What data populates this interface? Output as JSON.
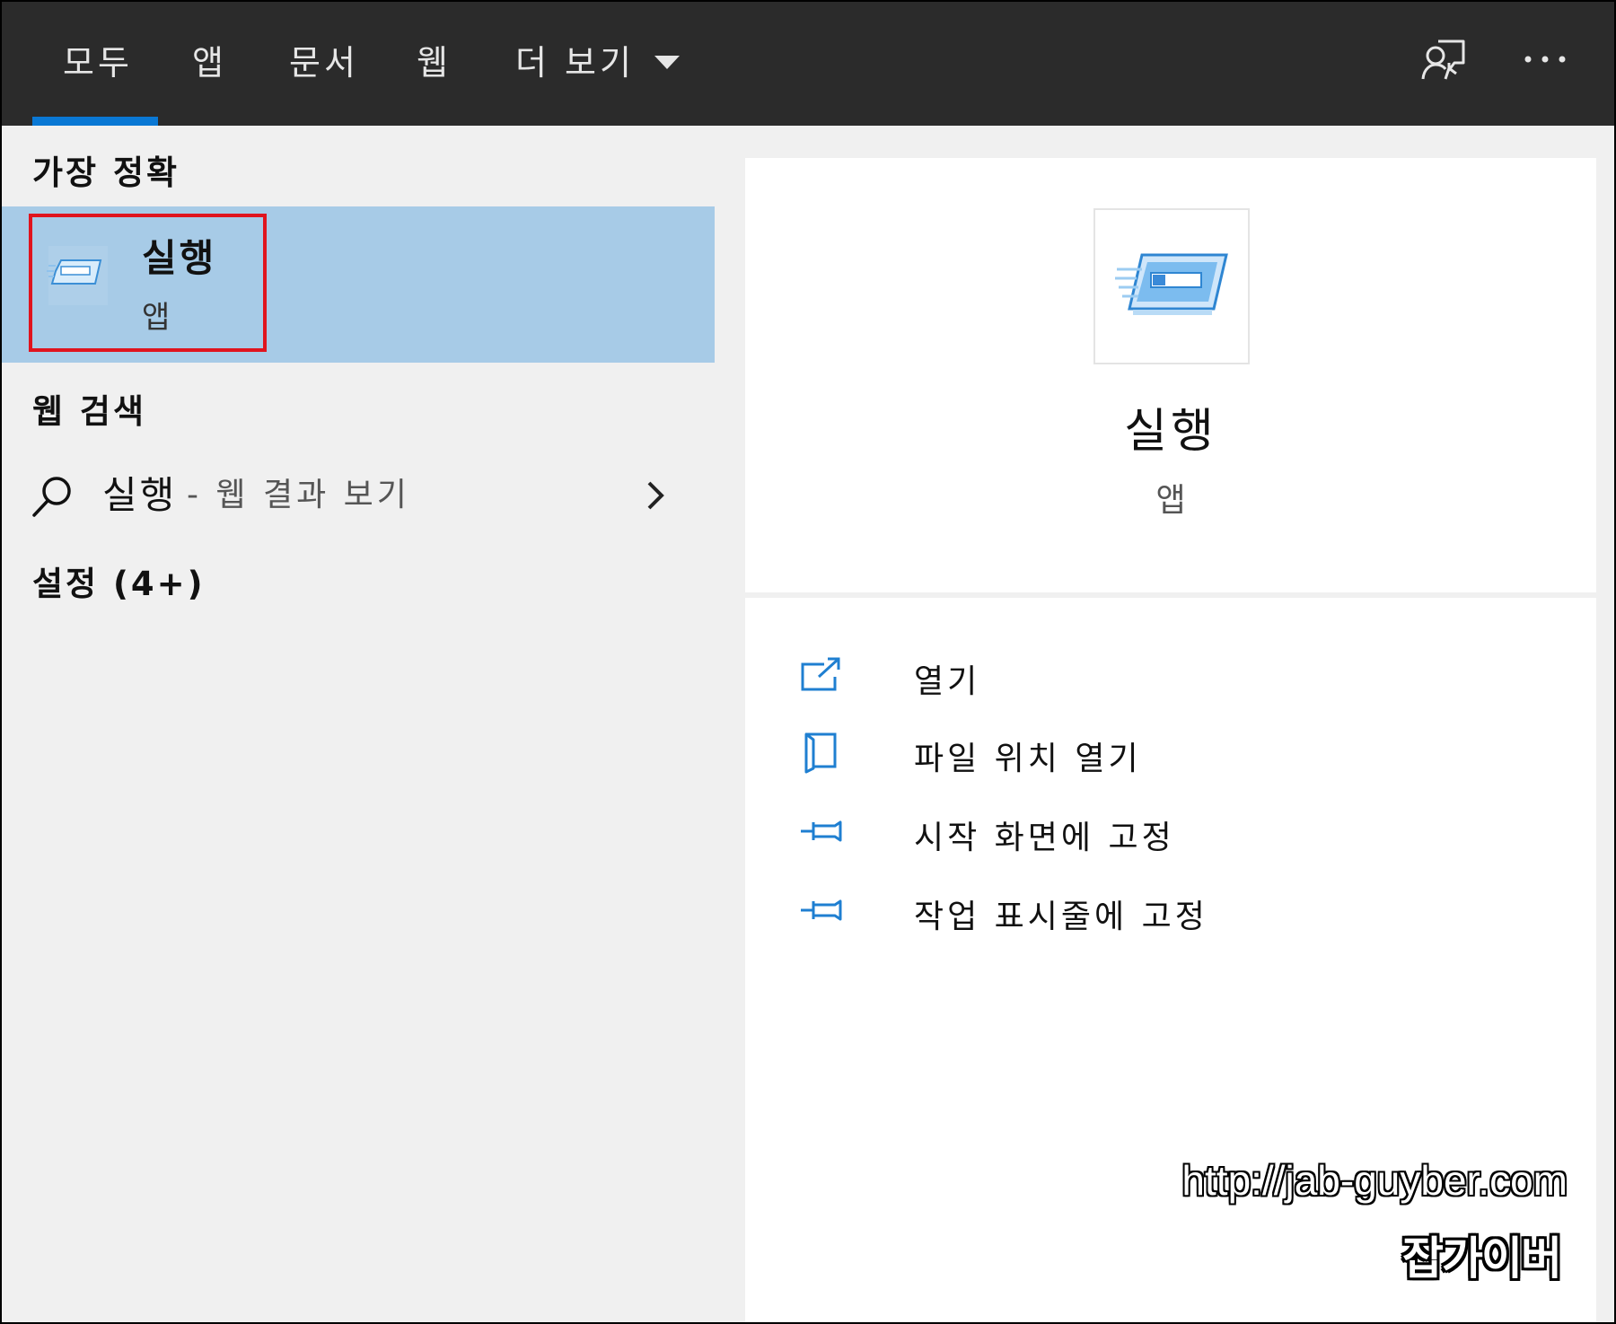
{
  "tabs": [
    {
      "label": "모두",
      "active": true
    },
    {
      "label": "앱"
    },
    {
      "label": "문서"
    },
    {
      "label": "웹"
    },
    {
      "label": "더 보기"
    }
  ],
  "topbar_icons": [
    "feedback-icon",
    "more-options-icon"
  ],
  "left": {
    "best_match_header": "가장 정확",
    "best_match": {
      "title": "실행",
      "subtitle": "앱",
      "icon": "run-app-icon"
    },
    "web_search_header": "웹 검색",
    "web_search": {
      "query": "실행",
      "suffix": "- 웹 결과 보기",
      "icon": "search-icon"
    },
    "settings_header": "설정 (4+)"
  },
  "preview": {
    "title": "실행",
    "subtitle": "앱",
    "actions": [
      {
        "label": "열기",
        "icon": "open-icon"
      },
      {
        "label": "파일 위치 열기",
        "icon": "file-location-icon"
      },
      {
        "label": "시작 화면에 고정",
        "icon": "pin-icon"
      },
      {
        "label": "작업 표시줄에 고정",
        "icon": "pin-icon"
      }
    ]
  },
  "watermark": {
    "url": "http://jab-guyber.com",
    "name": "잡가이버"
  },
  "colors": {
    "topbar": "#2b2b2b",
    "accent": "#0a78d4",
    "highlight": "#a7cbe7",
    "red_box": "#e0141e"
  }
}
